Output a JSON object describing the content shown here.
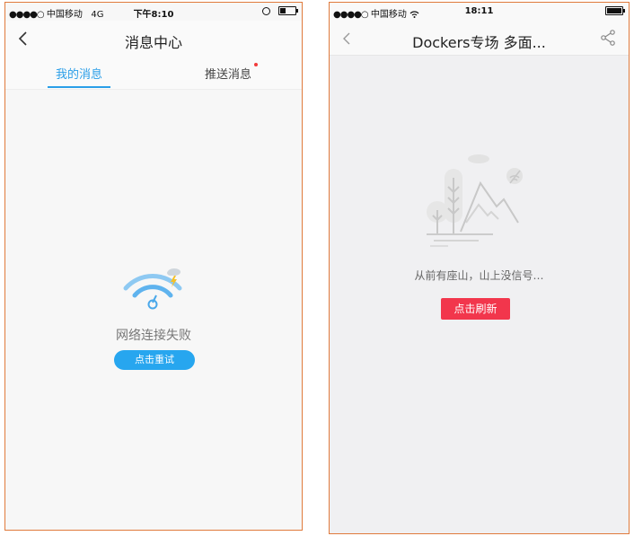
{
  "phone1": {
    "status": {
      "signal_dots": "●●●●○",
      "carrier": "中国移动",
      "network": "4G",
      "time": "下午8:10"
    },
    "nav": {
      "title": "消息中心"
    },
    "tabs": [
      {
        "label": "我的消息",
        "active": true
      },
      {
        "label": "推送消息",
        "active": false,
        "has_badge": true
      }
    ],
    "error": {
      "icon": "wifi-broken-icon",
      "message": "网络连接失败",
      "retry_label": "点击重试"
    },
    "colors": {
      "accent": "#2a9ee8",
      "button": "#27a6ef",
      "badge": "#f23b3b"
    }
  },
  "phone2": {
    "status": {
      "signal_dots": "●●●●○",
      "carrier": "中国移动",
      "time": "18:11"
    },
    "nav": {
      "title": "Dockers专场 多面..."
    },
    "empty": {
      "illustration": "mountain-no-signal-illustration",
      "message": "从前有座山，山上没信号…",
      "refresh_label": "点击刷新"
    },
    "colors": {
      "button": "#f2364c"
    }
  }
}
